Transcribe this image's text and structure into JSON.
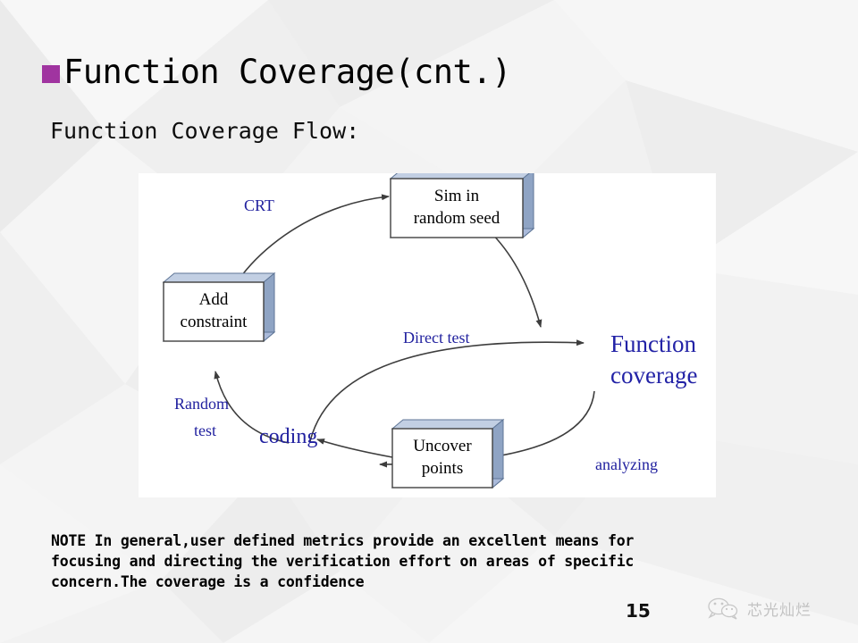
{
  "slide": {
    "title": "Function Coverage(cnt.)",
    "subtitle": "Function Coverage Flow:",
    "bullet_color": "#a034a0",
    "page_number": "15"
  },
  "diagram": {
    "nodes": [
      {
        "id": "sim",
        "label_line1": "Sim in",
        "label_line2": "random seed"
      },
      {
        "id": "add",
        "label_line1": "Add",
        "label_line2": "constraint"
      },
      {
        "id": "uncover",
        "label_line1": "Uncover",
        "label_line2": "points"
      }
    ],
    "text_nodes": [
      {
        "id": "function-coverage",
        "label_line1": "Function",
        "label_line2": "coverage"
      },
      {
        "id": "coding",
        "label_line1": "coding",
        "label_line2": ""
      }
    ],
    "edge_labels": [
      {
        "id": "crt",
        "line1": "CRT",
        "line2": ""
      },
      {
        "id": "direct-test",
        "line1": "Direct test",
        "line2": ""
      },
      {
        "id": "analyzing",
        "line1": "analyzing",
        "line2": ""
      },
      {
        "id": "random-test",
        "line1": "Random",
        "line2": "test"
      }
    ],
    "colors": {
      "node_fill": "#ffffff",
      "node_border": "#404040",
      "node_shadow": "#aabada",
      "node_shadow_dark": "#8fa4c4",
      "arrow": "#3d3d3d",
      "label_blue": "#2121a0",
      "panel_bg": "#ffffff"
    }
  },
  "note": {
    "label": "NOTE",
    "lines": [
      "NOTE In general,user defined metrics provide an excellent means for",
      "focusing and directing the verification effort on areas of specific",
      "concern.The coverage is a confidence"
    ]
  },
  "watermark": {
    "text": "芯光灿烂",
    "icon": "wechat-icon"
  }
}
